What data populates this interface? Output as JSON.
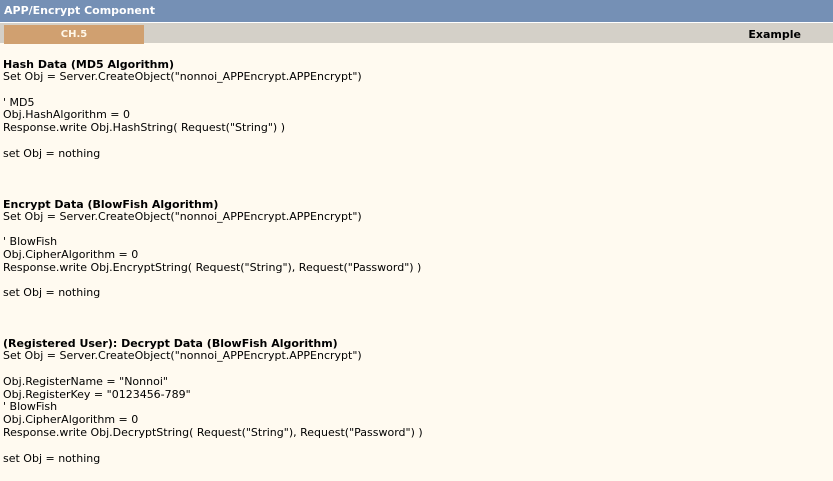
{
  "window": {
    "title": "APP/Encrypt Component"
  },
  "tabs": {
    "chapter": "CH.5",
    "example": "Example"
  },
  "sections": [
    {
      "title": "Hash Data (MD5 Algorithm)",
      "lines": [
        "Set Obj = Server.CreateObject(\"nonnoi_APPEncrypt.APPEncrypt\")",
        "",
        "' MD5",
        "Obj.HashAlgorithm = 0",
        "Response.write Obj.HashString( Request(\"String\") )",
        "",
        "set Obj = nothing"
      ]
    },
    {
      "title": "Encrypt Data (BlowFish Algorithm)",
      "lines": [
        "Set Obj = Server.CreateObject(\"nonnoi_APPEncrypt.APPEncrypt\")",
        "",
        "' BlowFish",
        "Obj.CipherAlgorithm = 0",
        "Response.write Obj.EncryptString( Request(\"String\"), Request(\"Password\") )",
        "",
        "set Obj = nothing"
      ]
    },
    {
      "title": "(Registered User): Decrypt Data (BlowFish Algorithm)",
      "lines": [
        "Set Obj = Server.CreateObject(\"nonnoi_APPEncrypt.APPEncrypt\")",
        "",
        "Obj.RegisterName = \"Nonnoi\"",
        "Obj.RegisterKey = \"0123456-789\"",
        "' BlowFish",
        "Obj.CipherAlgorithm = 0",
        "Response.write Obj.DecryptString( Request(\"String\"), Request(\"Password\") )",
        "",
        "set Obj = nothing"
      ]
    }
  ]
}
